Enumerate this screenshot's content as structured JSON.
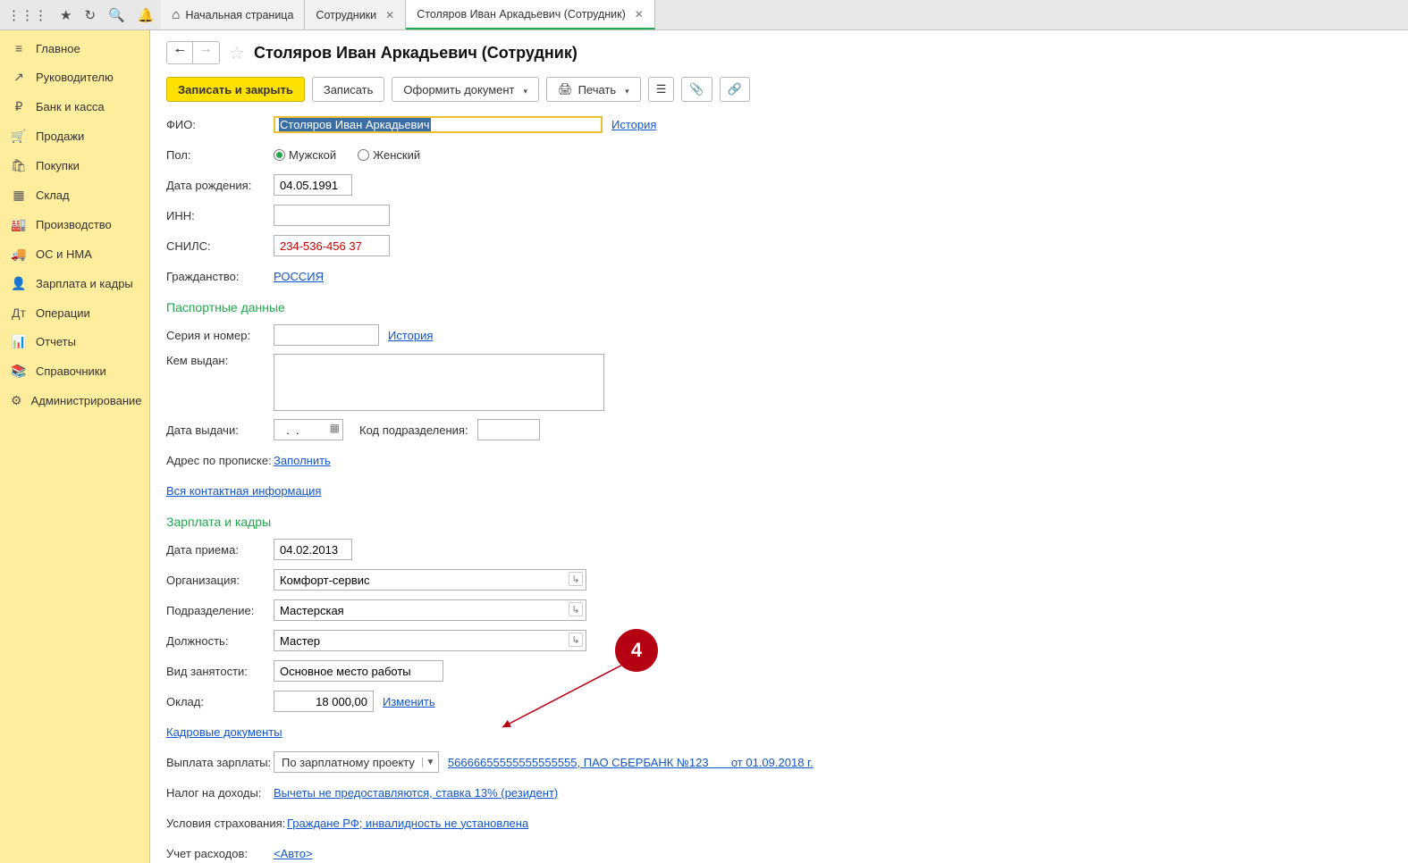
{
  "tabs": {
    "home": "Начальная страница",
    "t1": "Сотрудники",
    "t2": "Столяров Иван Аркадьевич (Сотрудник)"
  },
  "sidebar": [
    {
      "icon": "≡",
      "label": "Главное"
    },
    {
      "icon": "↗",
      "label": "Руководителю"
    },
    {
      "icon": "₽",
      "label": "Банк и касса"
    },
    {
      "icon": "🛒",
      "label": "Продажи"
    },
    {
      "icon": "🛍",
      "label": "Покупки"
    },
    {
      "icon": "▦",
      "label": "Склад"
    },
    {
      "icon": "🏭",
      "label": "Производство"
    },
    {
      "icon": "🚚",
      "label": "ОС и НМА"
    },
    {
      "icon": "👤",
      "label": "Зарплата и кадры"
    },
    {
      "icon": "Дт",
      "label": "Операции"
    },
    {
      "icon": "📊",
      "label": "Отчеты"
    },
    {
      "icon": "📚",
      "label": "Справочники"
    },
    {
      "icon": "⚙",
      "label": "Администрирование"
    }
  ],
  "title": "Столяров Иван Аркадьевич (Сотрудник)",
  "toolbar": {
    "save_close": "Записать и закрыть",
    "save": "Записать",
    "issue_doc": "Оформить документ",
    "print": "Печать"
  },
  "labels": {
    "fio": "ФИО:",
    "history": "История",
    "sex": "Пол:",
    "male": "Мужской",
    "female": "Женский",
    "dob": "Дата рождения:",
    "inn": "ИНН:",
    "snils": "СНИЛС:",
    "citizenship": "Гражданство:",
    "passport_h": "Паспортные данные",
    "series": "Серия и номер:",
    "issued_by": "Кем выдан:",
    "issue_date": "Дата выдачи:",
    "dept_code": "Код подразделения:",
    "reg_addr": "Адрес по прописке:",
    "fill": "Заполнить",
    "all_contacts": "Вся контактная информация",
    "hr_h": "Зарплата и кадры",
    "hire_date": "Дата приема:",
    "org": "Организация:",
    "dept": "Подразделение:",
    "position": "Должность:",
    "emp_type": "Вид занятости:",
    "salary": "Оклад:",
    "change": "Изменить",
    "hr_docs": "Кадровые документы",
    "pay_method": "Выплата зарплаты:",
    "income_tax": "Налог на доходы:",
    "insurance": "Условия страхования:",
    "accounting": "Учет расходов:"
  },
  "values": {
    "fio": "Столяров Иван Аркадьевич",
    "dob": "04.05.1991",
    "inn": "",
    "snils": "234-536-456 37",
    "citizenship": "РОССИЯ",
    "series": "",
    "issued_by": "",
    "issue_date": "  .  .",
    "dept_code": "",
    "hire_date": "04.02.2013",
    "org": "Комфорт-сервис",
    "dept": "Мастерская",
    "position": "Мастер",
    "emp_type": "Основное место работы",
    "salary": "18 000,00",
    "pay_method_combo": "По зарплатному проекту",
    "pay_method_link": "56666655555555555555, ПАО СБЕРБАНК №123       от 01.09.2018 г.",
    "income_tax": "Вычеты не предоставляются, ставка 13% (резидент)",
    "insurance": "Граждане РФ; инвалидность не установлена",
    "accounting": "<Авто>"
  },
  "annotation": {
    "num": "4"
  }
}
